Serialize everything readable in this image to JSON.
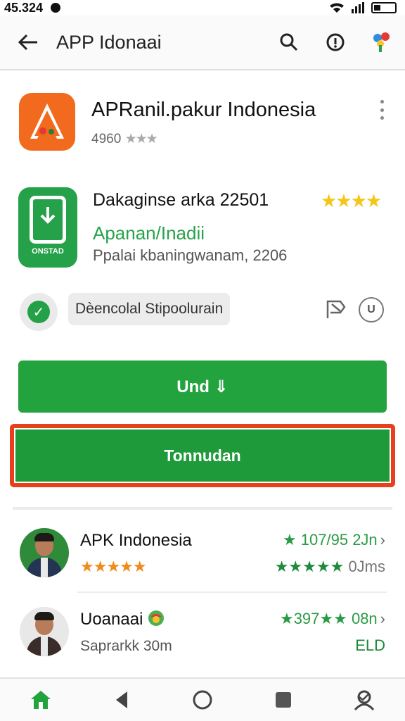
{
  "status_bar": {
    "time": "45.324"
  },
  "app_bar": {
    "title": "APP Idonaai"
  },
  "hero": {
    "title": "APRanil.pakur Indonesia",
    "rating": "4960",
    "stars": "★★★"
  },
  "card": {
    "title": "Dakaginse arka 22501",
    "stars": "★★★★",
    "link": "Apanan/Inadii",
    "meta": "Ppalai kbaningwanam, 2206",
    "icon_label": "ONSTAD"
  },
  "badge_row": {
    "chip": "Dèencolal Stipoolurain",
    "u_icon": "U"
  },
  "buttons": {
    "primary": "Und ⇓",
    "secondary": "Tonnudan"
  },
  "reviews": [
    {
      "name": "APK Indonesia",
      "stars": "★★★★★",
      "score": "★ 107/95 2Jn",
      "right2_stars": "★★★★★",
      "right2_text": "0Jms"
    },
    {
      "name": "Uoanaai",
      "sub": "Saprarkk 30m",
      "score": "★397★★ 08n",
      "right2": "ELD"
    }
  ],
  "colors": {
    "accent": "#23a33e",
    "frame": "#e8401c",
    "brand": "#f26a1e"
  },
  "icons": [
    "back-arrow-icon",
    "search-icon",
    "info-icon",
    "app-logo-icon",
    "kebab-icon",
    "check-icon",
    "flag-icon",
    "home-icon",
    "back-icon",
    "circle-icon",
    "square-icon",
    "profile-icon"
  ]
}
